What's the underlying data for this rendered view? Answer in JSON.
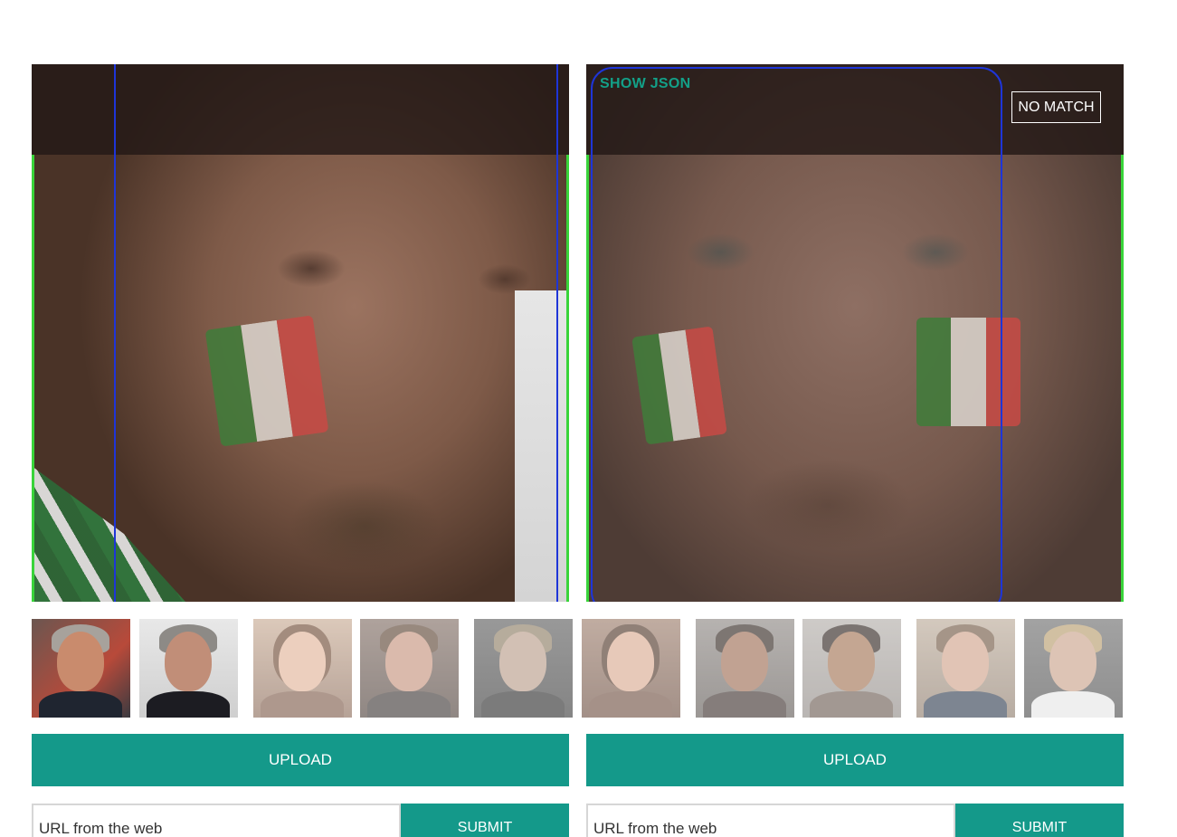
{
  "left_panel": {
    "image_alt": "face photo with italian flag face paint"
  },
  "right_panel": {
    "show_json_label": "SHOW JSON",
    "result_label": "NO MATCH"
  },
  "thumbnails": [
    {
      "name": "george-clooney-1"
    },
    {
      "name": "george-clooney-2"
    },
    {
      "name": "angelina-jolie-1"
    },
    {
      "name": "bradley-cooper-1"
    },
    {
      "name": "brad-pitt-1"
    },
    {
      "name": "angelina-jolie-2"
    },
    {
      "name": "halle-berry-1"
    },
    {
      "name": "halle-berry-2"
    },
    {
      "name": "bradley-cooper-2"
    },
    {
      "name": "brad-pitt-2"
    }
  ],
  "left_controls": {
    "upload_label": "UPLOAD",
    "url_placeholder": "URL from the web",
    "submit_label": "SUBMIT"
  },
  "right_controls": {
    "upload_label": "UPLOAD",
    "url_placeholder": "URL from the web",
    "submit_label": "SUBMIT"
  },
  "colors": {
    "accent": "#14998a",
    "show_json": "#13a088",
    "face_box": "#1e35d8",
    "match_frame": "#39d43a"
  }
}
